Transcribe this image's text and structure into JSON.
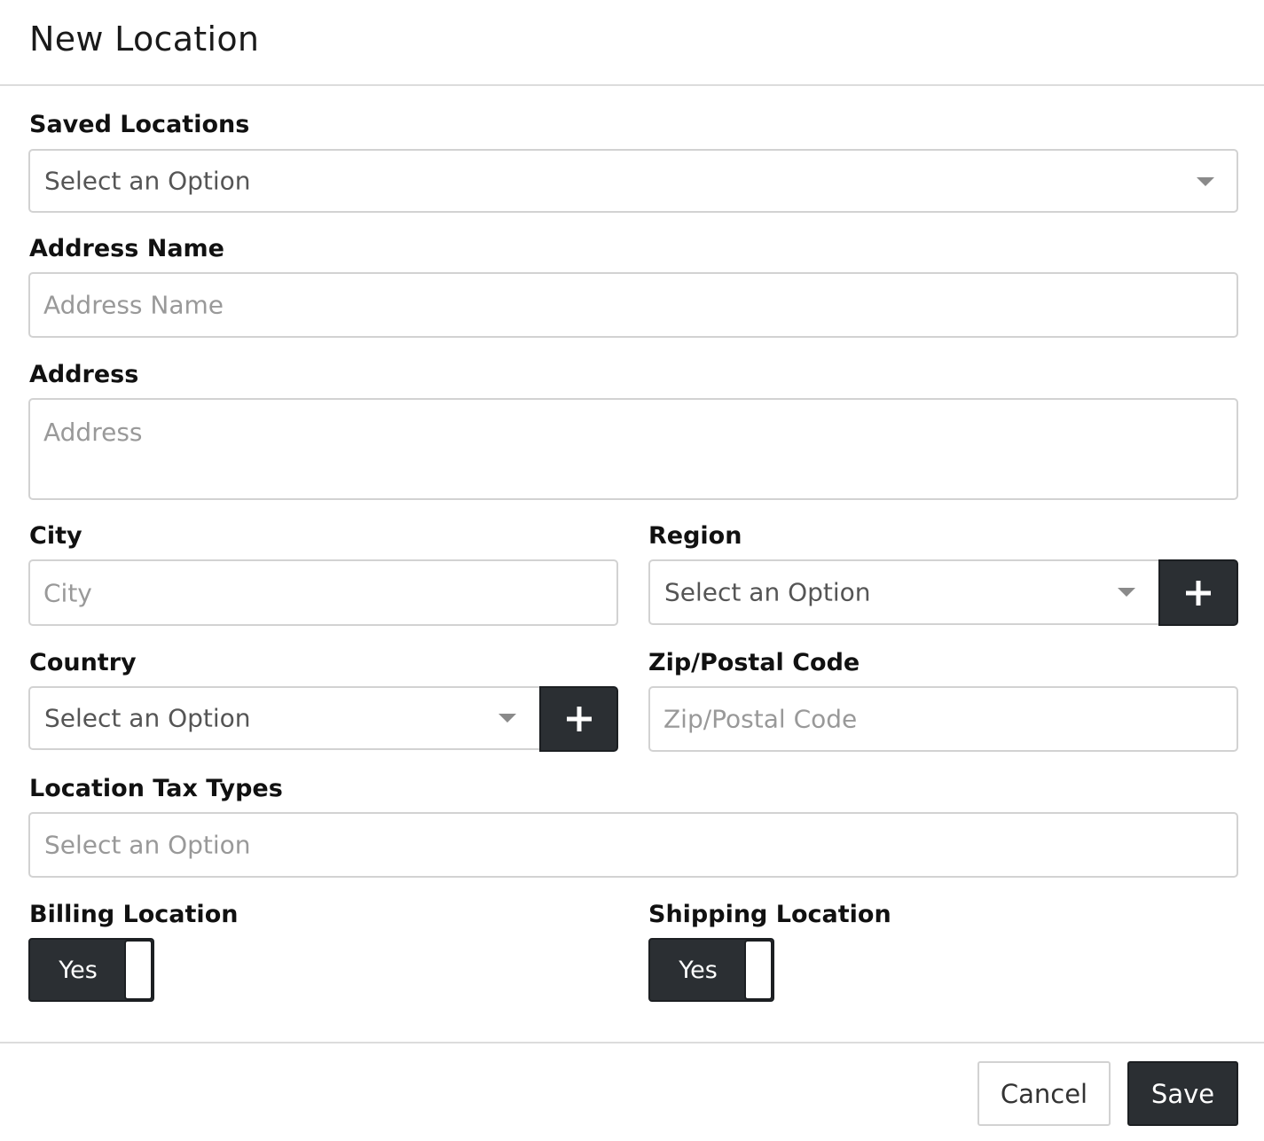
{
  "modal": {
    "title": "New Location"
  },
  "fields": {
    "saved_locations": {
      "label": "Saved Locations",
      "value": "Select an Option"
    },
    "address_name": {
      "label": "Address Name",
      "placeholder": "Address Name"
    },
    "address": {
      "label": "Address",
      "placeholder": "Address"
    },
    "city": {
      "label": "City",
      "placeholder": "City"
    },
    "region": {
      "label": "Region",
      "value": "Select an Option"
    },
    "country": {
      "label": "Country",
      "value": "Select an Option"
    },
    "zip": {
      "label": "Zip/Postal Code",
      "placeholder": "Zip/Postal Code"
    },
    "tax_types": {
      "label": "Location Tax Types",
      "placeholder": "Select an Option"
    },
    "billing": {
      "label": "Billing Location",
      "value": "Yes"
    },
    "shipping": {
      "label": "Shipping Location",
      "value": "Yes"
    }
  },
  "footer": {
    "cancel_label": "Cancel",
    "save_label": "Save"
  },
  "icons": {
    "dropdown": "chevron-down-icon",
    "add": "plus-icon"
  },
  "colors": {
    "primary_dark": "#2b2f33",
    "border": "#d2d2d2",
    "placeholder": "#999999"
  }
}
